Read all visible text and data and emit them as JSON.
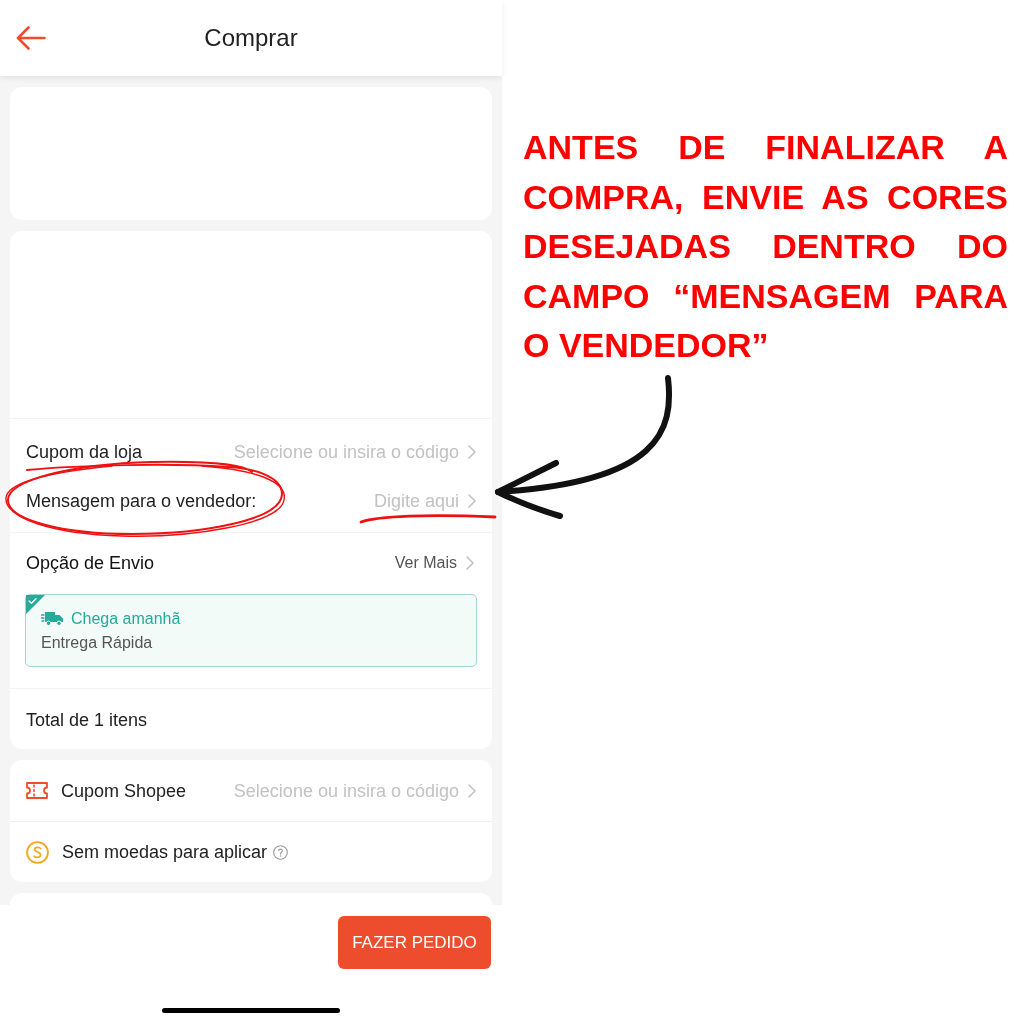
{
  "header": {
    "title": "Comprar"
  },
  "shop_section": {
    "coupon": {
      "label": "Cupom da loja",
      "value": "Selecione ou insira o código"
    },
    "message": {
      "label": "Mensagem para o vendedor:",
      "placeholder": "Digite aqui"
    },
    "shipping": {
      "title": "Opção de Envio",
      "link": "Ver Mais",
      "options": [
        {
          "title": "Chega amanhã",
          "subtitle": "Entrega Rápida",
          "selected": true
        }
      ]
    },
    "total": "Total de 1 itens"
  },
  "platform_section": {
    "rows": [
      {
        "kind": "coupon",
        "label": "Cupom Shopee",
        "value": "Selecione ou insira o código"
      },
      {
        "kind": "coins",
        "label": "Sem moedas para aplicar"
      }
    ]
  },
  "footer": {
    "button": "FAZER PEDIDO"
  },
  "annotation": {
    "text": "ANTES DE FINALIZAR A COMPRA, ENVIE AS CORES DESEJADAS DENTRO DO CAMPO “MENSAGEM PARA O VENDEDOR”"
  }
}
